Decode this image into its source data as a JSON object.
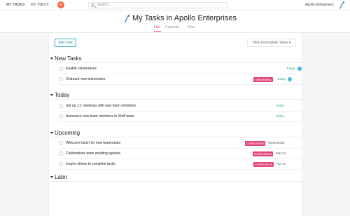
{
  "topbar": {
    "my_tasks": "MY TASKS",
    "my_inbox": "MY INBOX",
    "add_icon": "+",
    "search_placeholder": "Search...",
    "org_name": "Apollo Enterprises"
  },
  "header": {
    "title": "My Tasks in Apollo Enterprises",
    "tabs": [
      {
        "label": "List",
        "active": true
      },
      {
        "label": "Calendar",
        "active": false
      },
      {
        "label": "Files",
        "active": false
      }
    ]
  },
  "toolbar": {
    "add_task": "Add Task",
    "view_filter": "View Incomplete Tasks ▾"
  },
  "sections": [
    {
      "label": "New Tasks",
      "tasks": [
        {
          "name": "Enable celebrations",
          "tag": "",
          "due": "Today",
          "due_status": "today",
          "assignee": true
        },
        {
          "name": "Onboard new teammates",
          "tag": "Onboarding",
          "due": "Today",
          "due_status": "today",
          "assignee": true
        }
      ]
    },
    {
      "label": "Today",
      "tasks": [
        {
          "name": "Set up 1:1 meetings with new team members",
          "tag": "",
          "due": "Today",
          "due_status": "today",
          "assignee": false
        },
        {
          "name": "Announce new team members to Staff team",
          "tag": "",
          "due": "Today",
          "due_status": "today",
          "assignee": false
        }
      ]
    },
    {
      "label": "Upcoming",
      "tasks": [
        {
          "name": "Welcome lunch for new teammates",
          "tag": "Celebrations",
          "due": "Wednesday",
          "due_status": "future",
          "assignee": false
        },
        {
          "name": "Celebrations team meeting agenda",
          "tag": "Celebrations",
          "due": "Mar 24",
          "due_status": "future",
          "assignee": false
        },
        {
          "name": "Inspire others to complete tasks",
          "tag": "Celebrations",
          "due": "Apr 14",
          "due_status": "future",
          "assignee": false
        }
      ]
    },
    {
      "label": "Later",
      "tasks": []
    }
  ],
  "colors": {
    "accent": "#ff6b4a",
    "tag": "#e0437a",
    "due_today": "#27a36e",
    "add_task_border": "#3ab0c5"
  },
  "icons": {
    "add": "plus-icon",
    "search": "search-icon",
    "logo": "apollo-logo-icon",
    "caret": "caret-down-icon",
    "check": "checkmark-circle-icon",
    "avatar": "avatar"
  }
}
